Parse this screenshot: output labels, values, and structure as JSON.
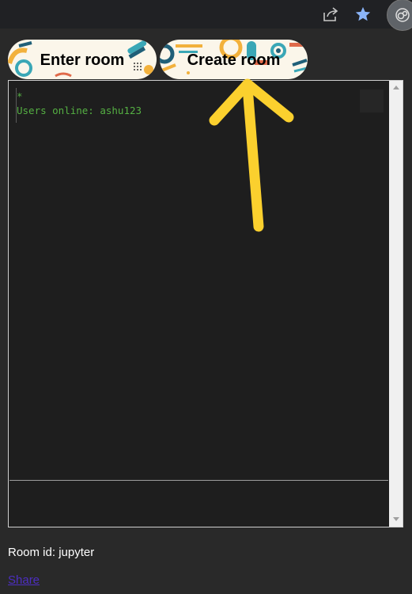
{
  "browser_bar": {
    "icons": [
      "share-icon",
      "star-icon",
      "extension-icon"
    ],
    "star_color": "#8ab4f8"
  },
  "buttons": {
    "enter_room": "Enter room",
    "create_room": "Create room"
  },
  "chat": {
    "lines": [
      "*",
      "Users online: ashu123"
    ],
    "text_color": "#55b043",
    "background": "#1e1e1e"
  },
  "room": {
    "label": "Room id: jupyter"
  },
  "share_link": "Share",
  "annotation": {
    "arrow_color": "#fbd02e"
  }
}
